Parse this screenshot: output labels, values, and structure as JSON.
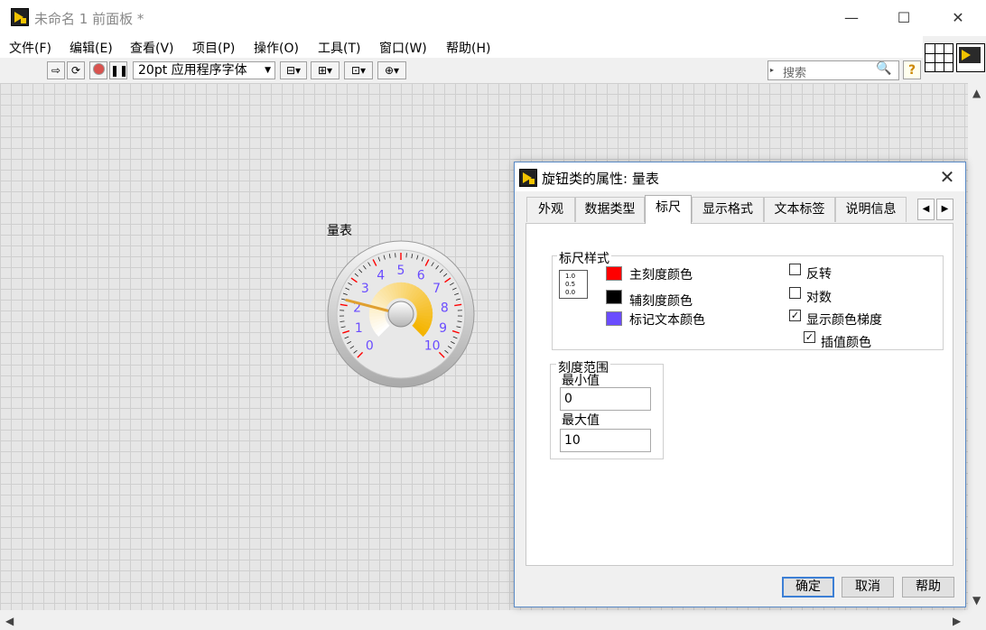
{
  "window": {
    "title": "未命名 1 前面板 *",
    "minimize": "—",
    "maximize": "☐",
    "close": "✕"
  },
  "menu": [
    "文件(F)",
    "编辑(E)",
    "查看(V)",
    "项目(P)",
    "操作(O)",
    "工具(T)",
    "窗口(W)",
    "帮助(H)"
  ],
  "toolbar": {
    "font": "20pt 应用程序字体",
    "search_placeholder": "搜索",
    "help_label": "?"
  },
  "gauge": {
    "label": "量表",
    "min": 0,
    "max": 10,
    "value": 2.2,
    "ticks": [
      "0",
      "1",
      "2",
      "3",
      "4",
      "5",
      "6",
      "7",
      "8",
      "9",
      "10"
    ],
    "gradient_colors": [
      "#ffffff",
      "#f4b400"
    ],
    "needle_color": "#e0a030",
    "major_tick_color": "#ff0000",
    "marker_text_color": "#6a4cff"
  },
  "dialog": {
    "title": "旋钮类的属性: 量表",
    "close": "✕",
    "tabs": [
      "外观",
      "数据类型",
      "标尺",
      "显示格式",
      "文本标签",
      "说明信息"
    ],
    "active_tab": "标尺",
    "tab_prev": "◀",
    "tab_next": "▶",
    "scale_style": {
      "title": "标尺样式",
      "icon_lines": [
        "1.0",
        "0.5",
        "0.0"
      ],
      "colors": [
        {
          "label": "主刻度颜色",
          "color": "#ff0000"
        },
        {
          "label": "辅刻度颜色",
          "color": "#000000"
        },
        {
          "label": "标记文本颜色",
          "color": "#6a4cff"
        }
      ],
      "options": [
        {
          "label": "反转",
          "checked": false
        },
        {
          "label": "对数",
          "checked": false
        },
        {
          "label": "显示颜色梯度",
          "checked": true
        },
        {
          "label": "插值颜色",
          "checked": true
        }
      ]
    },
    "scale_range": {
      "title": "刻度范围",
      "min_label": "最小值",
      "min_value": "0",
      "max_label": "最大值",
      "max_value": "10"
    },
    "buttons": {
      "ok": "确定",
      "cancel": "取消",
      "help": "帮助"
    }
  }
}
